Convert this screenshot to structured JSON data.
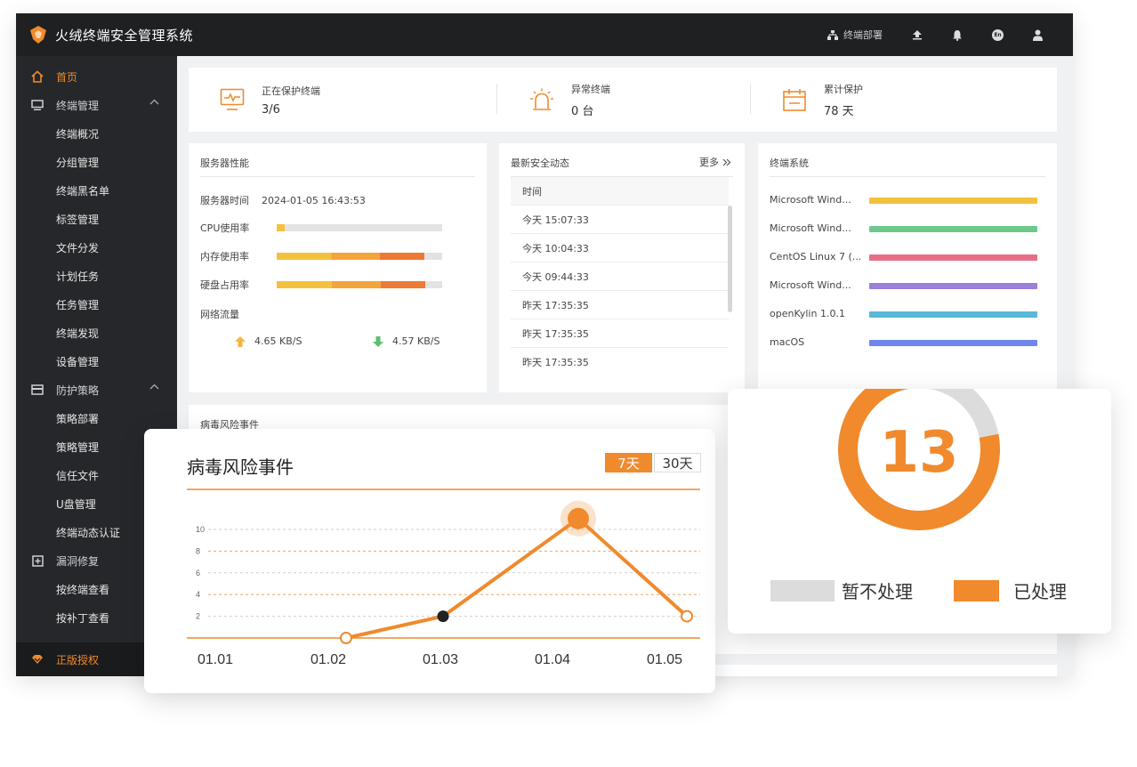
{
  "app": {
    "title": "火绒终端安全管理系统"
  },
  "topbar": {
    "deploy_label": "终端部署",
    "lang_badge": "En"
  },
  "sidebar": {
    "home": "首页",
    "terminal_mgmt": "终端管理",
    "terminal_items": [
      "终端概况",
      "分组管理",
      "终端黑名单",
      "标签管理",
      "文件分发",
      "计划任务",
      "任务管理",
      "终端发现",
      "设备管理"
    ],
    "protection": "防护策略",
    "protection_items": [
      "策略部署",
      "策略管理",
      "信任文件",
      "U盘管理",
      "终端动态认证"
    ],
    "vuln": "漏洞修复",
    "vuln_items": [
      "按终端查看",
      "按补丁查看"
    ],
    "license": "正版授权"
  },
  "stats": [
    {
      "label": "正在保护终端",
      "value": "3/6"
    },
    {
      "label": "异常终端",
      "value": "0 台"
    },
    {
      "label": "累计保护",
      "value": "78 天"
    }
  ],
  "server": {
    "title": "服务器性能",
    "time_label": "服务器时间",
    "time_value": "2024-01-05 16:43:53",
    "cpu_label": "CPU使用率",
    "mem_label": "内存使用率",
    "disk_label": "硬盘占用率",
    "net_label": "网络流量",
    "up_value": "4.65 KB/S",
    "down_value": "4.57 KB/S",
    "cpu_usage": 0.05,
    "mem_usage": 0.89,
    "disk_usage": 0.9
  },
  "events": {
    "title": "最新安全动态",
    "more": "更多",
    "col_time": "时间",
    "rows": [
      "今天 15:07:33",
      "今天 10:04:33",
      "今天 09:44:33",
      "昨天 17:35:35",
      "昨天 17:35:35",
      "昨天 17:35:35"
    ]
  },
  "os": {
    "title": "终端系统",
    "items": [
      {
        "name": "Microsoft Wind...",
        "color": "#f2c13d"
      },
      {
        "name": "Microsoft Wind...",
        "color": "#6cc98a"
      },
      {
        "name": "CentOS Linux 7 (...",
        "color": "#e86e86"
      },
      {
        "name": "Microsoft Wind...",
        "color": "#9b7fd8"
      },
      {
        "name": "openKylin 1.0.1",
        "color": "#5ab8d8"
      },
      {
        "name": "macOS",
        "color": "#6f86ee"
      }
    ]
  },
  "virus_panel_bg_title": "病毒风险事件",
  "virus_chart": {
    "title": "病毒风险事件",
    "tabs": [
      "7天",
      "30天"
    ],
    "active_tab": "7天"
  },
  "chart_data": {
    "type": "line",
    "categories": [
      "01.01",
      "01.02",
      "01.03",
      "01.04",
      "01.05"
    ],
    "y_ticks": [
      2,
      4,
      6,
      8,
      10
    ],
    "series": [
      {
        "values": [
          null,
          0,
          2,
          11,
          2
        ]
      }
    ],
    "ylim": [
      0,
      12
    ]
  },
  "donut": {
    "total": "13",
    "processed_fraction": 0.78,
    "legend": [
      "暂不处理",
      "已处理"
    ],
    "colors": {
      "processed": "#f08a2d",
      "unprocessed": "#dcdcdc"
    }
  },
  "colors": {
    "accent": "#f08a2d",
    "dark": "#1f2022"
  }
}
